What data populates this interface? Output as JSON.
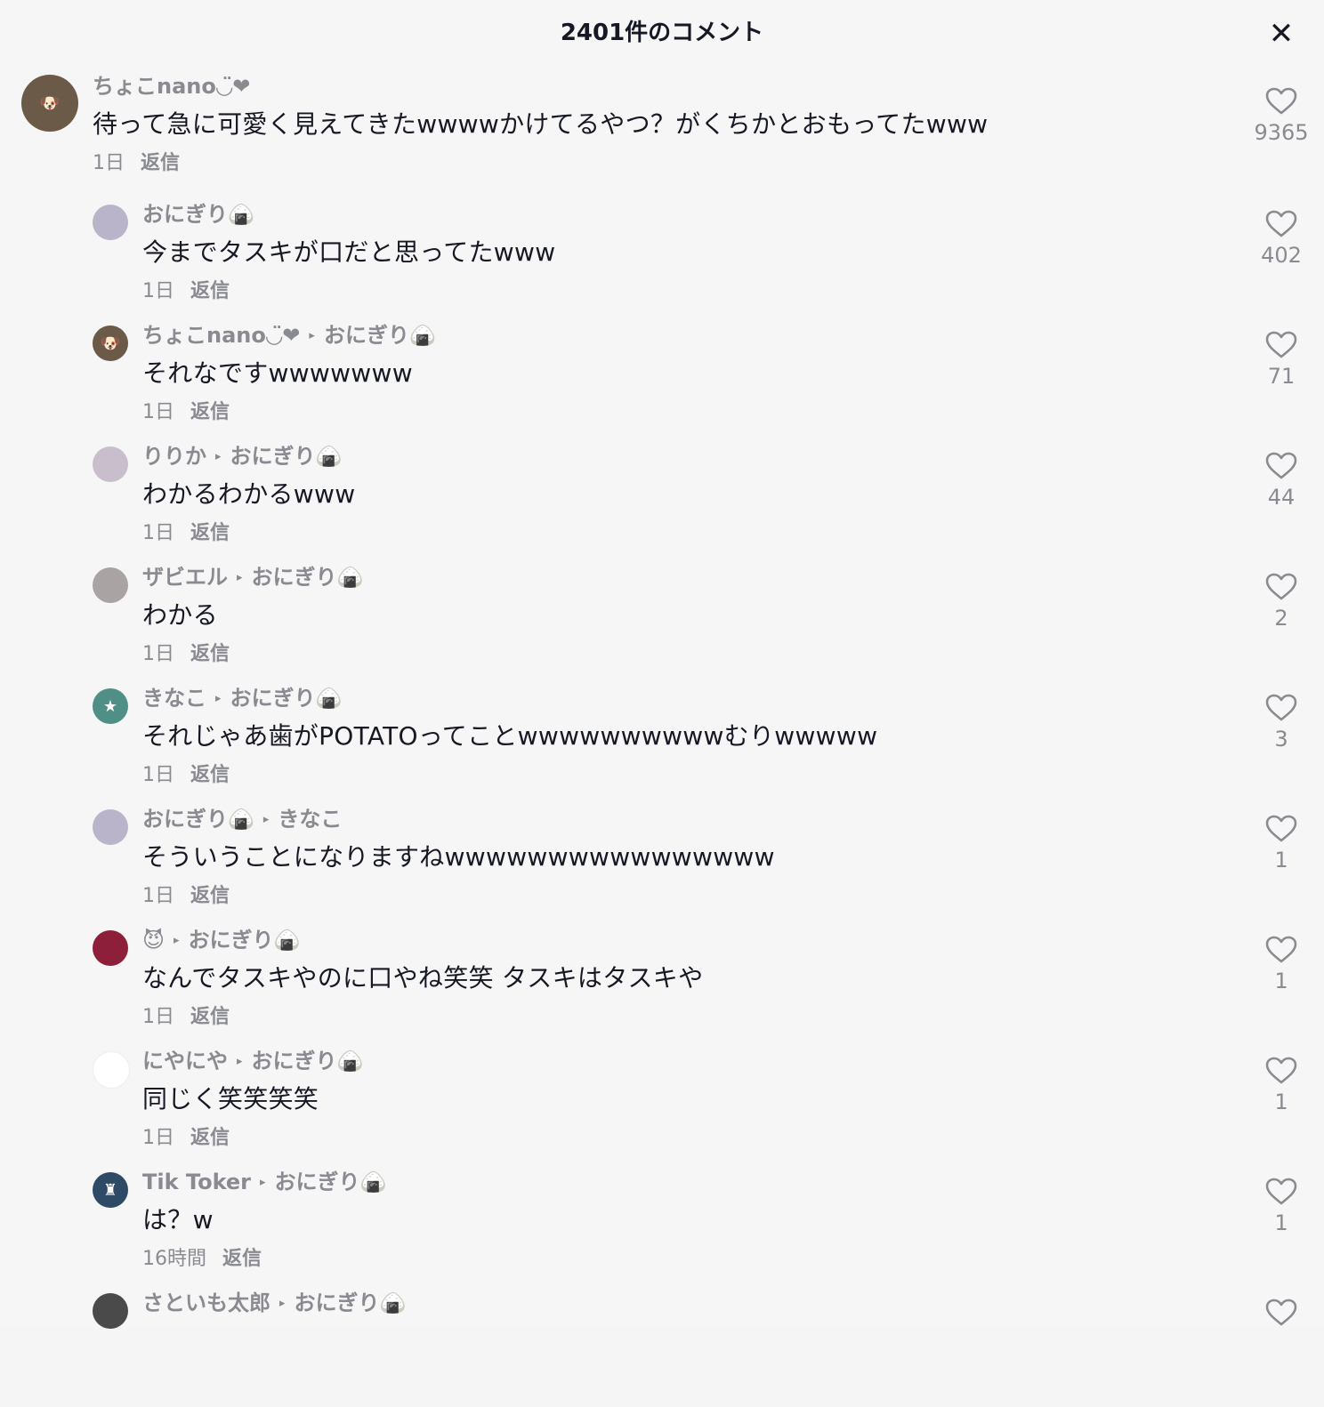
{
  "header": {
    "title": "2401件のコメント",
    "close_glyph": "✕"
  },
  "reply_label": "返信",
  "arrow_glyph": "▸",
  "comments": [
    {
      "author": "ちょこnano◡̈❤",
      "reply_to": "",
      "text": "待って急に可愛く見えてきたwwwwかけてるやつ？がくちかとおもってたwww",
      "time": "1日",
      "likes": "9365",
      "avatar_color": "#6b5a48",
      "avatar_glyph": "🐶"
    },
    {
      "author": "おにぎり🍙",
      "reply_to": "",
      "text": "今までタスキが口だと思ってたwww",
      "time": "1日",
      "likes": "402",
      "avatar_color": "#b9b4c9",
      "avatar_glyph": ""
    },
    {
      "author": "ちょこnano◡̈❤",
      "reply_to": "おにぎり🍙",
      "text": "それなですwwwwwww",
      "time": "1日",
      "likes": "71",
      "avatar_color": "#6b5a48",
      "avatar_glyph": "🐶"
    },
    {
      "author": "りりか",
      "reply_to": "おにぎり🍙",
      "text": "わかるわかるwww",
      "time": "1日",
      "likes": "44",
      "avatar_color": "#c9bfcc",
      "avatar_glyph": ""
    },
    {
      "author": "ザビエル",
      "reply_to": "おにぎり🍙",
      "text": "わかる",
      "time": "1日",
      "likes": "2",
      "avatar_color": "#a9a3a3",
      "avatar_glyph": ""
    },
    {
      "author": "きなこ",
      "reply_to": "おにぎり🍙",
      "text": "それじゃあ歯がPOTATOってことwwwwwwwwwwむりwwwww",
      "time": "1日",
      "likes": "3",
      "avatar_color": "#4f8f86",
      "avatar_glyph": "★"
    },
    {
      "author": "おにぎり🍙",
      "reply_to": "きなこ",
      "text": "そういうことになりますねwwwwwwwwwwwwwwww",
      "time": "1日",
      "likes": "1",
      "avatar_color": "#b9b4c9",
      "avatar_glyph": ""
    },
    {
      "author": "😈",
      "reply_to": "おにぎり🍙",
      "text": "なんでタスキやのに口やね笑笑 タスキはタスキや",
      "time": "1日",
      "likes": "1",
      "avatar_color": "#8e1f3a",
      "avatar_glyph": ""
    },
    {
      "author": "にやにや",
      "reply_to": "おにぎり🍙",
      "text": "同じく笑笑笑笑",
      "time": "1日",
      "likes": "1",
      "avatar_color": "#ffffff",
      "avatar_glyph": ""
    },
    {
      "author": "Tik Toker",
      "reply_to": "おにぎり🍙",
      "text": "は？w",
      "time": "16時間",
      "likes": "1",
      "avatar_color": "#2f4a66",
      "avatar_glyph": "♜"
    },
    {
      "author": "さといも太郎",
      "reply_to": "おにぎり🍙",
      "text": "",
      "time": "",
      "likes": "",
      "avatar_color": "#4a4a4a",
      "avatar_glyph": ""
    }
  ]
}
